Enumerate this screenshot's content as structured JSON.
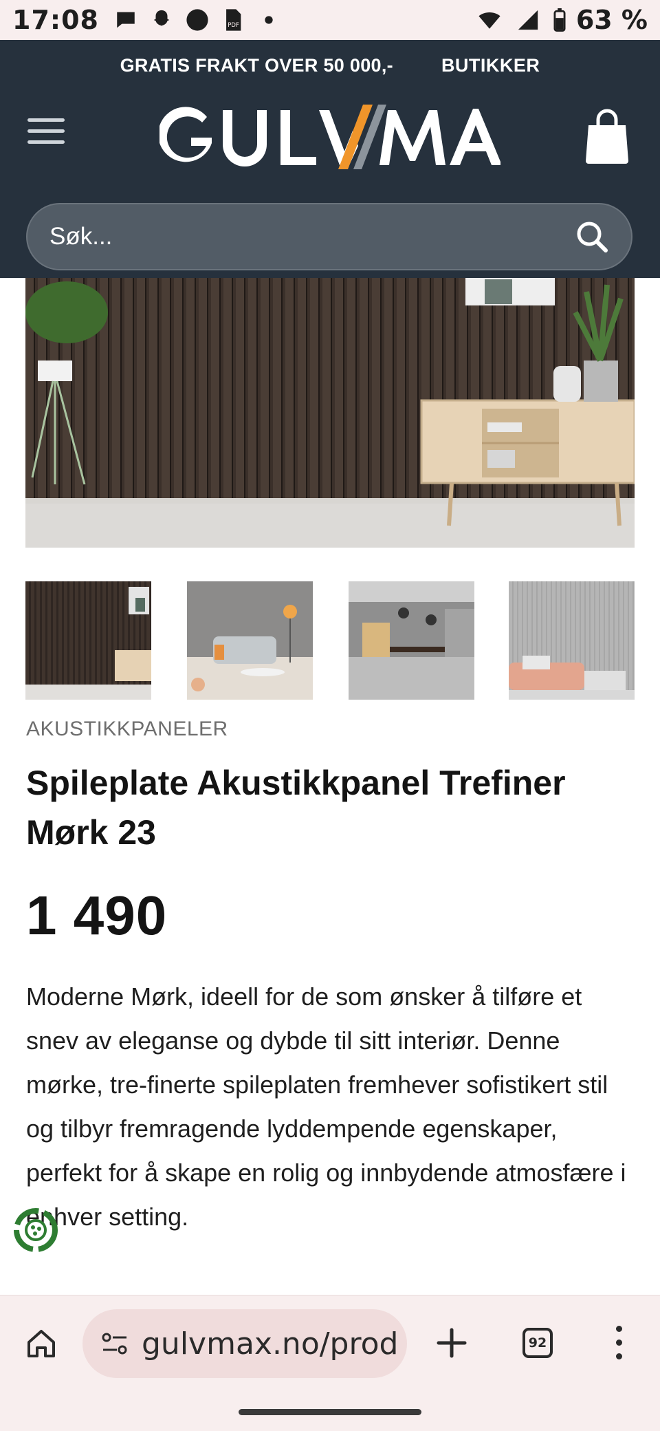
{
  "status_bar": {
    "time": "17:08",
    "battery": "63 %",
    "icons": [
      "chat-icon",
      "snapchat-icon",
      "circle-icon",
      "pdf-icon",
      "dot-icon",
      "wifi-icon",
      "signal-icon",
      "battery-icon"
    ]
  },
  "header": {
    "promo_text": "GRATIS FRAKT OVER 50 000,-",
    "stores_link": "BUTIKKER",
    "logo_text": "GULVMAX",
    "search_placeholder": "Søk...",
    "colors": {
      "background": "#26313d",
      "search": "#525c66",
      "logo_accent": "#f0952a"
    }
  },
  "gallery": {
    "main_image": "dark-oak-slat-acoustic-panel-wall-with-sideboard",
    "thumbnails": [
      "dark-slat-wall-sideboard",
      "living-room-sofa-orange-lamp",
      "restaurant-dining-hall",
      "grey-slat-wall-pink-sofa"
    ]
  },
  "product": {
    "category": "AKUSTIKKPANELER",
    "title": "Spileplate Akustikkpanel Trefiner Mørk 23",
    "price": "1 490",
    "description": "Moderne Mørk, ideell for de som ønsker å tilføre et snev av eleganse og dybde til sitt interiør. Denne mørke, tre-finerte spileplaten fremhever sofistikert stil og tilbyr fremragende lyddempende egenskaper, perfekt for å skape en rolig og innbydende atmosfære i enhver setting."
  },
  "browser": {
    "url": "gulvmax.no/prod",
    "tab_count": "92"
  }
}
